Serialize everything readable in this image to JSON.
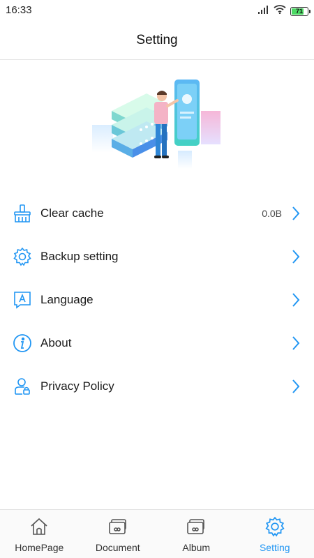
{
  "status_bar": {
    "time": "16:33",
    "battery": "71"
  },
  "header": {
    "title": "Setting"
  },
  "menu": {
    "items": [
      {
        "label": "Clear cache",
        "value": "0.0B",
        "icon": "broom-icon"
      },
      {
        "label": "Backup setting",
        "icon": "gear-icon"
      },
      {
        "label": "Language",
        "icon": "language-icon"
      },
      {
        "label": "About",
        "icon": "info-icon"
      },
      {
        "label": "Privacy Policy",
        "icon": "privacy-user-lock-icon"
      }
    ]
  },
  "tabs": [
    {
      "label": "HomePage",
      "icon": "home-icon",
      "active": false
    },
    {
      "label": "Document",
      "icon": "document-icon",
      "active": false
    },
    {
      "label": "Album",
      "icon": "album-icon",
      "active": false
    },
    {
      "label": "Setting",
      "icon": "gear-icon",
      "active": true
    }
  ],
  "colors": {
    "accent": "#2196f3",
    "text": "#1a1a1a",
    "divider": "#e4e4e4"
  }
}
